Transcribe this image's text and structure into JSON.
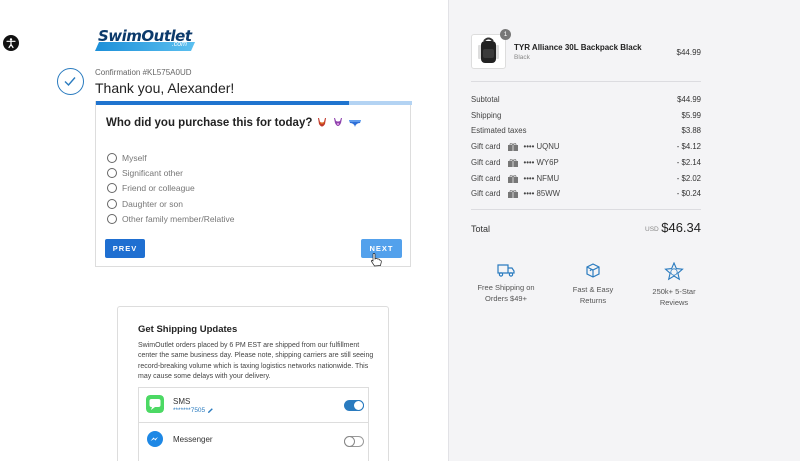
{
  "brand": {
    "name": "SwimOutlet",
    "suffix": ".com"
  },
  "confirmation": {
    "number": "Confirmation #KL575A0UD",
    "thanks": "Thank you, Alexander!"
  },
  "survey": {
    "progress": 0.8,
    "question": "Who did you purchase this for today?",
    "options": [
      "Myself",
      "Significant other",
      "Friend or colleague",
      "Daughter or son",
      "Other family member/Relative"
    ],
    "prev_label": "PREV",
    "next_label": "NEXT"
  },
  "shipping_updates": {
    "title": "Get Shipping Updates",
    "description": "SwimOutlet orders placed by 6 PM EST are shipped from our fulfillment center the same business day. Please note, shipping carriers are still seeing record-breaking volume which is taxing logistics networks nationwide. This may cause some delays with your delivery.",
    "channels": [
      {
        "name": "SMS",
        "detail": "*******7505",
        "enabled": true,
        "icon": "sms-icon"
      },
      {
        "name": "Messenger",
        "detail": "",
        "enabled": false,
        "icon": "messenger-icon"
      }
    ]
  },
  "order": {
    "product": {
      "name": "TYR Alliance 30L Backpack Black",
      "variant": "Black",
      "price": "$44.99",
      "quantity": "1"
    },
    "summary": [
      {
        "label": "Subtotal",
        "value": "$44.99"
      },
      {
        "label": "Shipping",
        "value": "$5.99"
      },
      {
        "label": "Estimated taxes",
        "value": "$3.88"
      }
    ],
    "gift_cards": [
      {
        "label": "Gift card",
        "code": "•••• UQNU",
        "value": "- $4.12"
      },
      {
        "label": "Gift card",
        "code": "•••• WY6P",
        "value": "- $2.14"
      },
      {
        "label": "Gift card",
        "code": "•••• NFMU",
        "value": "- $2.02"
      },
      {
        "label": "Gift card",
        "code": "•••• 85WW",
        "value": "- $0.24"
      }
    ],
    "total_label": "Total",
    "currency": "USD",
    "total": "$46.34"
  },
  "features": [
    {
      "line1": "Free Shipping on",
      "line2": "Orders $49+",
      "icon": "truck-icon"
    },
    {
      "line1": "Fast & Easy",
      "line2": "Returns",
      "icon": "return-box-icon"
    },
    {
      "line1": "250k+ 5-Star",
      "line2": "Reviews",
      "icon": "star-badge-icon"
    }
  ],
  "colors": {
    "accent": "#1f6fd1",
    "accent_light": "#53a1ec",
    "panel_bg": "#f4f4f6",
    "feature_blue": "#2a7bbf"
  }
}
